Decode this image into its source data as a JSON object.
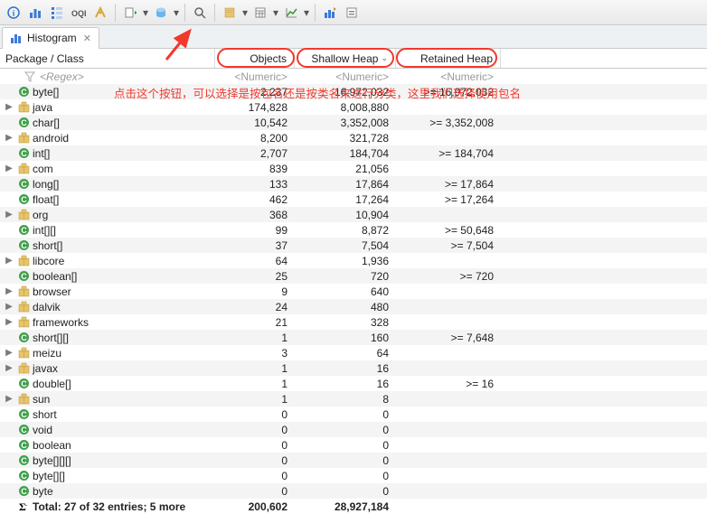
{
  "toolbar_icons": [
    "info-icon",
    "histogram-icon",
    "tree-icon",
    "oql-icon",
    "threads-icon",
    "sep",
    "run-icon",
    "run-dd",
    "query-icon",
    "query-dd",
    "sep",
    "search-icon",
    "sep",
    "groupby-icon",
    "groupby-dd",
    "calc-icon",
    "calc-dd",
    "chart-icon",
    "chart-dd",
    "sep",
    "export-icon",
    "compare-icon"
  ],
  "tab": {
    "label": "Histogram",
    "close_hint": "✕"
  },
  "columns": {
    "name": "Package / Class",
    "objects": "Objects",
    "shallow": "Shallow Heap",
    "retained": "Retained Heap"
  },
  "subheader": {
    "regex": "<Regex>",
    "objects": "<Numeric>",
    "shallow": "<Numeric>",
    "retained": "<Numeric>"
  },
  "rows": [
    {
      "exp": "",
      "icon": "class",
      "name": "byte[]",
      "obj": "2,237",
      "sh": "16,972,032",
      "rh": ">= 16,972,032"
    },
    {
      "exp": "▶",
      "icon": "pkg",
      "name": "java",
      "obj": "174,828",
      "sh": "8,008,880",
      "rh": ""
    },
    {
      "exp": "",
      "icon": "class",
      "name": "char[]",
      "obj": "10,542",
      "sh": "3,352,008",
      "rh": ">= 3,352,008"
    },
    {
      "exp": "▶",
      "icon": "pkg",
      "name": "android",
      "obj": "8,200",
      "sh": "321,728",
      "rh": ""
    },
    {
      "exp": "",
      "icon": "class",
      "name": "int[]",
      "obj": "2,707",
      "sh": "184,704",
      "rh": ">= 184,704"
    },
    {
      "exp": "▶",
      "icon": "pkg",
      "name": "com",
      "obj": "839",
      "sh": "21,056",
      "rh": ""
    },
    {
      "exp": "",
      "icon": "class",
      "name": "long[]",
      "obj": "133",
      "sh": "17,864",
      "rh": ">= 17,864"
    },
    {
      "exp": "",
      "icon": "class",
      "name": "float[]",
      "obj": "462",
      "sh": "17,264",
      "rh": ">= 17,264"
    },
    {
      "exp": "▶",
      "icon": "pkg",
      "name": "org",
      "obj": "368",
      "sh": "10,904",
      "rh": ""
    },
    {
      "exp": "",
      "icon": "class",
      "name": "int[][]",
      "obj": "99",
      "sh": "8,872",
      "rh": ">= 50,648"
    },
    {
      "exp": "",
      "icon": "class",
      "name": "short[]",
      "obj": "37",
      "sh": "7,504",
      "rh": ">= 7,504"
    },
    {
      "exp": "▶",
      "icon": "pkg",
      "name": "libcore",
      "obj": "64",
      "sh": "1,936",
      "rh": ""
    },
    {
      "exp": "",
      "icon": "class",
      "name": "boolean[]",
      "obj": "25",
      "sh": "720",
      "rh": ">= 720"
    },
    {
      "exp": "▶",
      "icon": "pkg",
      "name": "browser",
      "obj": "9",
      "sh": "640",
      "rh": ""
    },
    {
      "exp": "▶",
      "icon": "pkg",
      "name": "dalvik",
      "obj": "24",
      "sh": "480",
      "rh": ""
    },
    {
      "exp": "▶",
      "icon": "pkg",
      "name": "frameworks",
      "obj": "21",
      "sh": "328",
      "rh": ""
    },
    {
      "exp": "",
      "icon": "class",
      "name": "short[][]",
      "obj": "1",
      "sh": "160",
      "rh": ">= 7,648"
    },
    {
      "exp": "▶",
      "icon": "pkg",
      "name": "meizu",
      "obj": "3",
      "sh": "64",
      "rh": ""
    },
    {
      "exp": "▶",
      "icon": "pkg",
      "name": "javax",
      "obj": "1",
      "sh": "16",
      "rh": ""
    },
    {
      "exp": "",
      "icon": "class",
      "name": "double[]",
      "obj": "1",
      "sh": "16",
      "rh": ">= 16"
    },
    {
      "exp": "▶",
      "icon": "pkg",
      "name": "sun",
      "obj": "1",
      "sh": "8",
      "rh": ""
    },
    {
      "exp": "",
      "icon": "class",
      "name": "short",
      "obj": "0",
      "sh": "0",
      "rh": ""
    },
    {
      "exp": "",
      "icon": "class",
      "name": "void",
      "obj": "0",
      "sh": "0",
      "rh": ""
    },
    {
      "exp": "",
      "icon": "class",
      "name": "boolean",
      "obj": "0",
      "sh": "0",
      "rh": ""
    },
    {
      "exp": "",
      "icon": "class",
      "name": "byte[][][]",
      "obj": "0",
      "sh": "0",
      "rh": ""
    },
    {
      "exp": "",
      "icon": "class",
      "name": "byte[][]",
      "obj": "0",
      "sh": "0",
      "rh": ""
    },
    {
      "exp": "",
      "icon": "class",
      "name": "byte",
      "obj": "0",
      "sh": "0",
      "rh": ""
    }
  ],
  "total": {
    "label": "Total: 27 of 32 entries; 5 more",
    "obj": "200,602",
    "sh": "28,927,184",
    "rh": ""
  },
  "annotation": "点击这个按钮，可以选择是按包名还是按类名来进行分类，这里我们选择使用包名"
}
